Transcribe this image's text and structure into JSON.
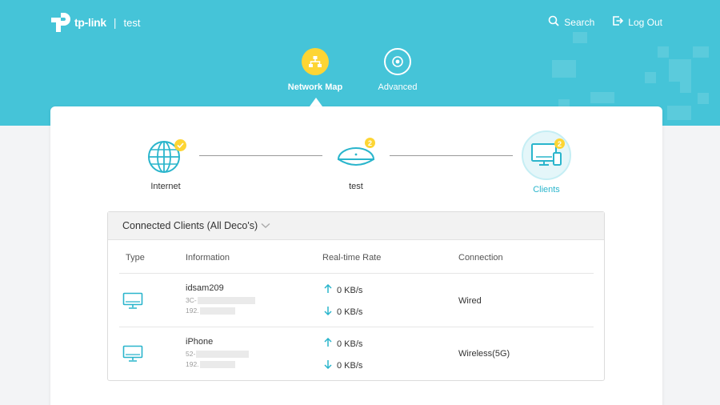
{
  "header": {
    "brand": "tp-link",
    "separator": "|",
    "device_name": "test",
    "links": {
      "search": "Search",
      "logout": "Log Out"
    },
    "tabs": [
      {
        "label": "Network Map",
        "active": true
      },
      {
        "label": "Advanced",
        "active": false
      }
    ]
  },
  "topology": {
    "internet": {
      "label": "Internet"
    },
    "deco": {
      "label": "test",
      "badge": "2"
    },
    "clients": {
      "label": "Clients",
      "badge": "2"
    }
  },
  "clients_panel": {
    "title": "Connected Clients (All Deco's)",
    "columns": [
      "Type",
      "Information",
      "Real-time Rate",
      "Connection"
    ],
    "rows": [
      {
        "type_icon": "desktop-icon",
        "name": "idsam209",
        "mac_prefix": "3C-",
        "ip_prefix": "192.",
        "upload": "0 KB/s",
        "download": "0 KB/s",
        "connection": "Wired"
      },
      {
        "type_icon": "desktop-icon",
        "name": "iPhone",
        "mac_prefix": "52-",
        "ip_prefix": "192.",
        "upload": "0 KB/s",
        "download": "0 KB/s",
        "connection": "Wireless(5G)"
      }
    ]
  },
  "colors": {
    "header_bg": "#45c4d8",
    "accent": "#2ab5cc",
    "highlight": "#fdd534"
  }
}
